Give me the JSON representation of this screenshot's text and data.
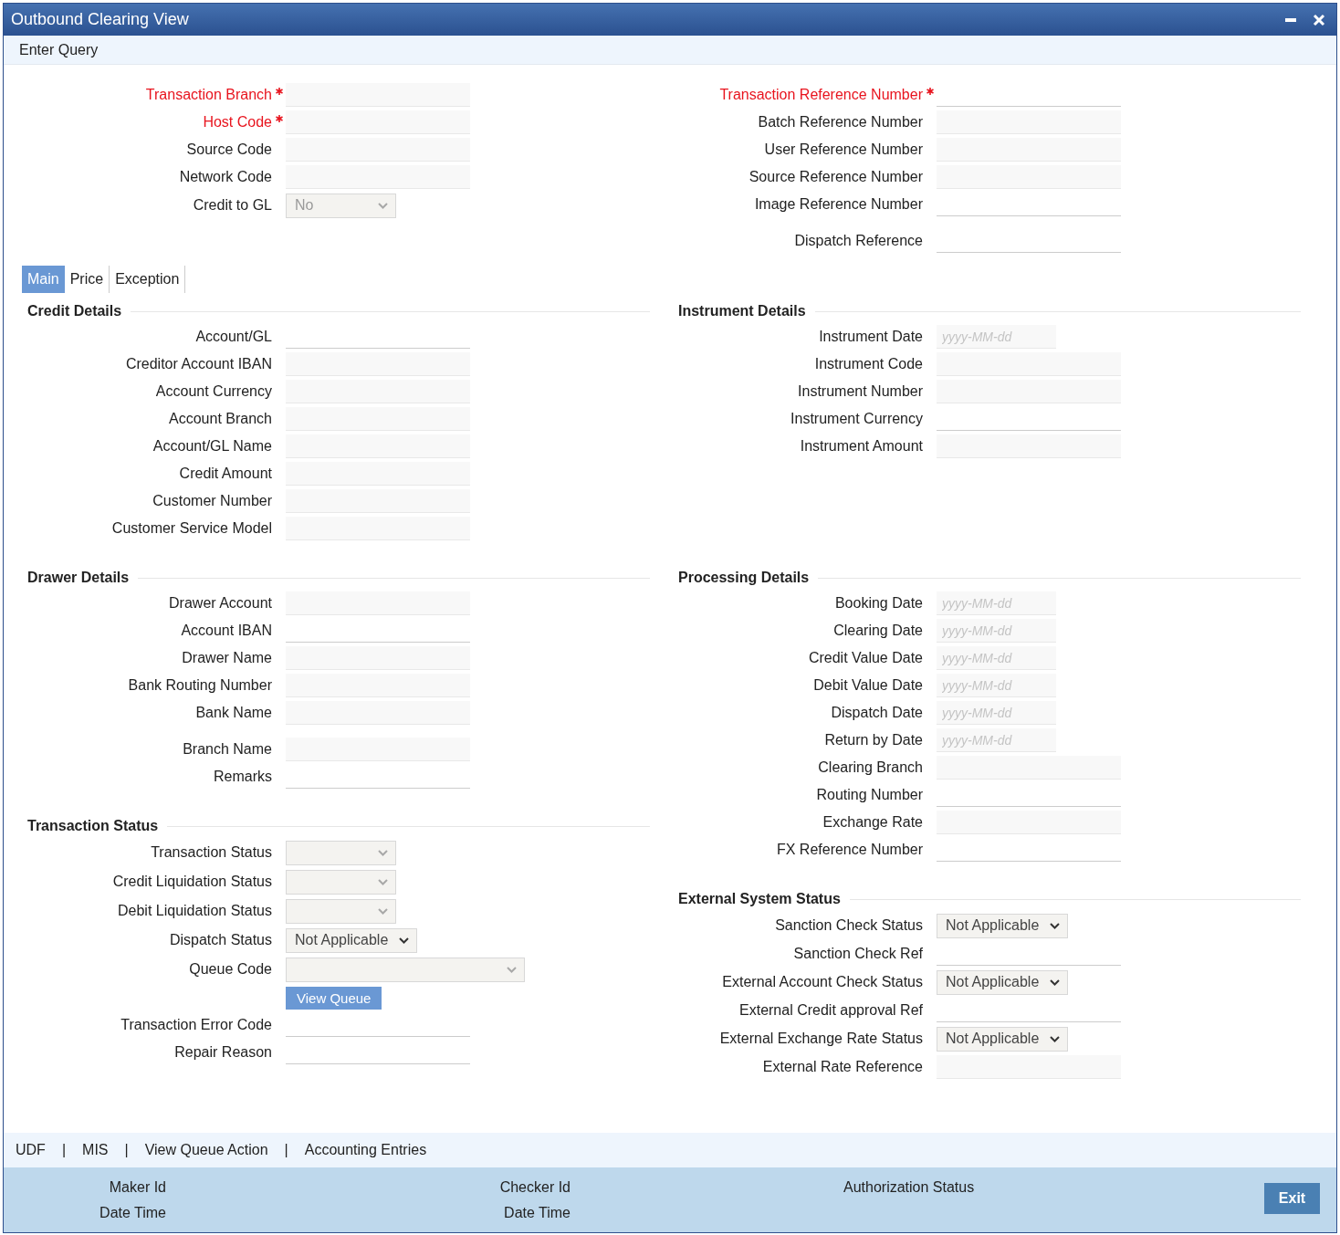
{
  "window": {
    "title": "Outbound Clearing View"
  },
  "toolbar": {
    "items": [
      "Enter Query"
    ]
  },
  "header": {
    "left": [
      [
        {
          "label": "Transaction Branch",
          "required": true,
          "kind": "text",
          "readonly": true
        },
        {
          "label": "Host Code",
          "required": true,
          "kind": "text",
          "readonly": true
        },
        {
          "label": "Source Code",
          "required": false,
          "kind": "text",
          "readonly": true
        },
        {
          "label": "Network Code",
          "required": false,
          "kind": "text",
          "readonly": true
        },
        {
          "label": "Credit to GL",
          "required": false,
          "kind": "select",
          "readonly": true,
          "value": "No"
        }
      ]
    ],
    "right": [
      [
        {
          "label": "Transaction Reference Number",
          "required": true,
          "kind": "text",
          "readonly": false
        },
        {
          "label": "Batch Reference Number",
          "required": false,
          "kind": "text",
          "readonly": true
        },
        {
          "label": "User Reference Number",
          "required": false,
          "kind": "text",
          "readonly": true
        },
        {
          "label": "Source Reference Number",
          "required": false,
          "kind": "text",
          "readonly": true
        },
        {
          "label": "Image Reference Number",
          "required": false,
          "kind": "text",
          "readonly": false
        }
      ],
      [
        {
          "label": "Dispatch Reference",
          "required": false,
          "kind": "text",
          "readonly": false
        }
      ]
    ]
  },
  "tabs": [
    {
      "label": "Main",
      "selected": true
    },
    {
      "label": "Price",
      "selected": false
    },
    {
      "label": "Exception",
      "selected": false
    }
  ],
  "body": [
    {
      "left": [
        {
          "title": "Credit Details",
          "groups": [
            [
              {
                "label": "Account/GL",
                "kind": "text",
                "readonly": false
              },
              {
                "label": "Creditor Account IBAN",
                "kind": "text",
                "readonly": true
              },
              {
                "label": "Account Currency",
                "kind": "text",
                "readonly": true
              },
              {
                "label": "Account Branch",
                "kind": "text",
                "readonly": true
              },
              {
                "label": "Account/GL Name",
                "kind": "text",
                "readonly": true
              },
              {
                "label": "Credit Amount",
                "kind": "text",
                "readonly": true
              },
              {
                "label": "Customer Number",
                "kind": "text",
                "readonly": true
              },
              {
                "label": "Customer Service Model",
                "kind": "text",
                "readonly": true
              }
            ]
          ]
        }
      ],
      "right": [
        {
          "title": "Instrument Details",
          "groups": [
            [
              {
                "label": "Instrument Date",
                "kind": "date",
                "readonly": true,
                "placeholder": "yyyy-MM-dd"
              },
              {
                "label": "Instrument Code",
                "kind": "text",
                "readonly": true
              },
              {
                "label": "Instrument Number",
                "kind": "text",
                "readonly": true
              },
              {
                "label": "Instrument Currency",
                "kind": "text",
                "readonly": false
              },
              {
                "label": "Instrument Amount",
                "kind": "text",
                "readonly": true
              }
            ]
          ]
        }
      ]
    },
    {
      "left": [
        {
          "title": "Drawer Details",
          "groups": [
            [
              {
                "label": "Drawer Account",
                "kind": "text",
                "readonly": true
              },
              {
                "label": "Account IBAN",
                "kind": "text",
                "readonly": false
              },
              {
                "label": "Drawer Name",
                "kind": "text",
                "readonly": true
              },
              {
                "label": "Bank Routing Number",
                "kind": "text",
                "readonly": true
              },
              {
                "label": "Bank Name",
                "kind": "text",
                "readonly": true
              }
            ],
            [
              {
                "label": "Branch Name",
                "kind": "text",
                "readonly": true
              },
              {
                "label": "Remarks",
                "kind": "text",
                "readonly": false
              }
            ]
          ]
        },
        {
          "title": "Transaction Status",
          "groups": [
            [
              {
                "label": "Transaction Status",
                "kind": "select",
                "readonly": true
              },
              {
                "label": "Credit Liquidation Status",
                "kind": "select",
                "readonly": true
              },
              {
                "label": "Debit Liquidation Status",
                "kind": "select",
                "readonly": true
              },
              {
                "label": "Dispatch Status",
                "kind": "select",
                "readonly": false,
                "value": "Not Applicable"
              },
              {
                "label": "Queue Code",
                "kind": "wide_select",
                "readonly": true
              },
              {
                "kind": "button",
                "value": "View Queue"
              },
              {
                "label": "Transaction Error Code",
                "kind": "text",
                "readonly": false
              },
              {
                "label": "Repair Reason",
                "kind": "text",
                "readonly": false
              }
            ]
          ]
        }
      ],
      "right": [
        {
          "title": "Processing Details",
          "groups": [
            [
              {
                "label": "Booking Date",
                "kind": "date",
                "readonly": true,
                "placeholder": "yyyy-MM-dd"
              },
              {
                "label": "Clearing Date",
                "kind": "date",
                "readonly": true,
                "placeholder": "yyyy-MM-dd"
              },
              {
                "label": "Credit Value Date",
                "kind": "date",
                "readonly": true,
                "placeholder": "yyyy-MM-dd"
              },
              {
                "label": "Debit Value Date",
                "kind": "date",
                "readonly": true,
                "placeholder": "yyyy-MM-dd"
              },
              {
                "label": "Dispatch Date",
                "kind": "date",
                "readonly": true,
                "placeholder": "yyyy-MM-dd"
              },
              {
                "label": "Return by Date",
                "kind": "date",
                "readonly": true,
                "placeholder": "yyyy-MM-dd"
              },
              {
                "label": "Clearing Branch",
                "kind": "text",
                "readonly": true
              },
              {
                "label": "Routing Number",
                "kind": "text",
                "readonly": false
              },
              {
                "label": "Exchange Rate",
                "kind": "text",
                "readonly": true
              },
              {
                "label": "FX Reference Number",
                "kind": "text",
                "readonly": false
              }
            ]
          ]
        },
        {
          "title": "External System Status",
          "groups": [
            [
              {
                "label": "Sanction Check Status",
                "kind": "select",
                "readonly": false,
                "value": "Not Applicable"
              },
              {
                "label": "Sanction Check Ref",
                "kind": "text",
                "readonly": false
              },
              {
                "label": "External Account Check Status",
                "kind": "select",
                "readonly": false,
                "value": "Not Applicable"
              },
              {
                "label": "External Credit approval Ref",
                "kind": "text",
                "readonly": false
              },
              {
                "label": "External Exchange Rate Status",
                "kind": "select",
                "readonly": false,
                "value": "Not Applicable"
              },
              {
                "label": "External Rate Reference",
                "kind": "text",
                "readonly": true
              }
            ]
          ]
        }
      ]
    }
  ],
  "footer_links": [
    {
      "kind": "link",
      "label": "UDF"
    },
    {
      "kind": "separator",
      "label": "|"
    },
    {
      "kind": "link",
      "label": "MIS"
    },
    {
      "kind": "separator",
      "label": "|"
    },
    {
      "kind": "link",
      "label": "View Queue Action"
    },
    {
      "kind": "separator",
      "label": "|"
    },
    {
      "kind": "link",
      "label": "Accounting Entries"
    }
  ],
  "audit": {
    "columns": [
      {
        "lines": [
          "Maker Id",
          "Date Time"
        ]
      },
      {
        "lines": [
          "Checker Id",
          "Date Time"
        ]
      },
      {
        "lines": [
          "Authorization Status"
        ]
      }
    ],
    "exit_button": "Exit"
  }
}
